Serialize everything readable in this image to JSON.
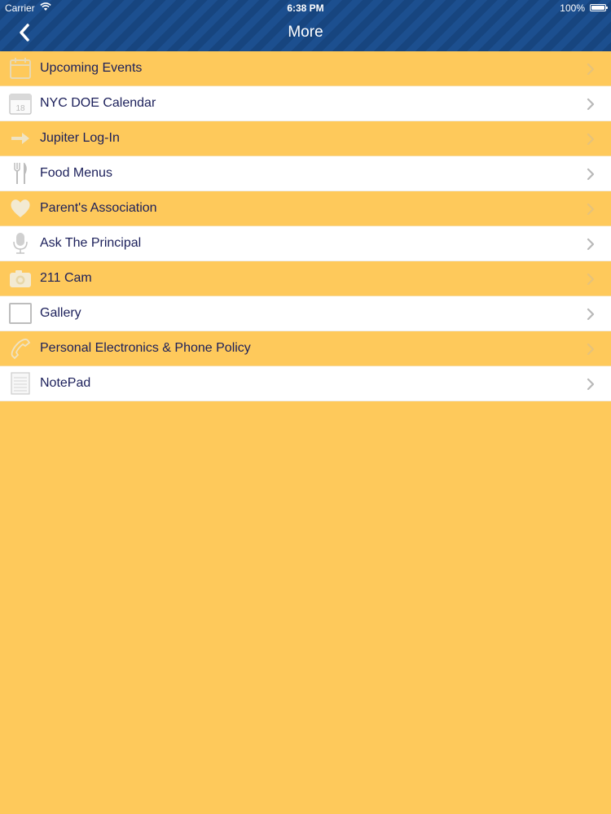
{
  "status_bar": {
    "carrier": "Carrier",
    "time": "6:38 PM",
    "battery": "100%"
  },
  "nav": {
    "title": "More",
    "back_icon": "chevron-left-icon"
  },
  "colors": {
    "nav_bar": "#1c4f8f",
    "row_yellow": "#FEC95B",
    "row_white": "#ffffff",
    "label_text": "#1b1f5a",
    "icon_gray": "#c9c9c9"
  },
  "menu": {
    "items": [
      {
        "label": "Upcoming Events",
        "icon": "events-icon"
      },
      {
        "label": "NYC DOE Calendar",
        "icon": "calendar-icon"
      },
      {
        "label": "Jupiter Log-In",
        "icon": "arrow-icon"
      },
      {
        "label": "Food Menus",
        "icon": "fork-knife-icon"
      },
      {
        "label": "Parent's Association",
        "icon": "heart-icon"
      },
      {
        "label": "Ask The Principal",
        "icon": "microphone-icon"
      },
      {
        "label": "211 Cam",
        "icon": "camera-icon"
      },
      {
        "label": "Gallery",
        "icon": "gallery-icon"
      },
      {
        "label": "Personal Electronics & Phone Policy",
        "icon": "phone-icon"
      },
      {
        "label": "NotePad",
        "icon": "notepad-icon"
      }
    ]
  }
}
